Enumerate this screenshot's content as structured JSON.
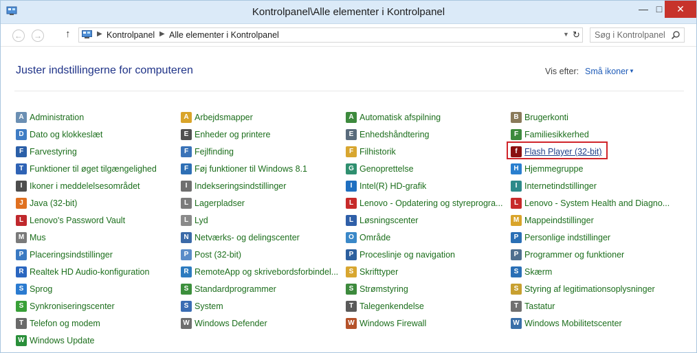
{
  "window": {
    "title": "Kontrolpanel\\Alle elementer i Kontrolpanel",
    "controls": {
      "minimize": "—",
      "maximize": "□",
      "close": "✕"
    }
  },
  "nav": {
    "back_icon": "←",
    "forward_icon": "→",
    "up_icon": "↑",
    "breadcrumb": [
      "Kontrolpanel",
      "Alle elementer i Kontrolpanel"
    ],
    "dropdown_icon": "▼",
    "refresh_icon": "↻",
    "search_placeholder": "Søg i Kontrolpanel"
  },
  "header": {
    "title": "Juster indstillingerne for computeren",
    "view_label": "Vis efter:",
    "view_value": "Små ikoner",
    "view_caret": "▼"
  },
  "columns": [
    [
      {
        "label": "Administration",
        "icon": "admin-tools-icon",
        "color": "#6b8fb3",
        "glyph": "A"
      },
      {
        "label": "Dato og klokkeslæt",
        "icon": "clock-icon",
        "color": "#3f7cc4",
        "glyph": "D"
      },
      {
        "label": "Farvestyring",
        "icon": "color-management-icon",
        "color": "#2b5fa8",
        "glyph": "F"
      },
      {
        "label": "Funktioner til øget tilgængelighed",
        "icon": "accessibility-icon",
        "color": "#2f63b5",
        "glyph": "T"
      },
      {
        "label": "Ikoner i meddelelsesområdet",
        "icon": "notification-icons-icon",
        "color": "#4d4d4d",
        "glyph": "I"
      },
      {
        "label": "Java (32-bit)",
        "icon": "java-icon",
        "color": "#e07020",
        "glyph": "J"
      },
      {
        "label": "Lenovo's Password Vault",
        "icon": "password-vault-icon",
        "color": "#c0282d",
        "glyph": "L"
      },
      {
        "label": "Mus",
        "icon": "mouse-icon",
        "color": "#7a7a7a",
        "glyph": "M"
      },
      {
        "label": "Placeringsindstillinger",
        "icon": "location-icon",
        "color": "#3a79c2",
        "glyph": "P"
      },
      {
        "label": "Realtek HD Audio-konfiguration",
        "icon": "realtek-audio-icon",
        "color": "#2a66c0",
        "glyph": "R"
      },
      {
        "label": "Sprog",
        "icon": "language-icon",
        "color": "#2b7bd0",
        "glyph": "S"
      },
      {
        "label": "Synkroniseringscenter",
        "icon": "sync-center-icon",
        "color": "#39a038",
        "glyph": "S"
      },
      {
        "label": "Telefon og modem",
        "icon": "phone-modem-icon",
        "color": "#6a6a6a",
        "glyph": "T"
      },
      {
        "label": "Windows Update",
        "icon": "windows-update-icon",
        "color": "#2a8f3a",
        "glyph": "W"
      }
    ],
    [
      {
        "label": "Arbejdsmapper",
        "icon": "work-folders-icon",
        "color": "#d9a42a",
        "glyph": "A"
      },
      {
        "label": "Enheder og printere",
        "icon": "devices-printers-icon",
        "color": "#505050",
        "glyph": "E"
      },
      {
        "label": "Fejlfinding",
        "icon": "troubleshooting-icon",
        "color": "#3a73b8",
        "glyph": "F"
      },
      {
        "label": "Føj funktioner til Windows 8.1",
        "icon": "add-features-icon",
        "color": "#2e6fb5",
        "glyph": "F"
      },
      {
        "label": "Indekseringsindstillinger",
        "icon": "indexing-icon",
        "color": "#6f6f6f",
        "glyph": "I"
      },
      {
        "label": "Lagerpladser",
        "icon": "storage-spaces-icon",
        "color": "#7b7b7b",
        "glyph": "L"
      },
      {
        "label": "Lyd",
        "icon": "sound-icon",
        "color": "#8a8a8a",
        "glyph": "L"
      },
      {
        "label": "Netværks- og delingscenter",
        "icon": "network-icon",
        "color": "#3b6aa8",
        "glyph": "N"
      },
      {
        "label": "Post (32-bit)",
        "icon": "mail-icon",
        "color": "#5a8cc8",
        "glyph": "P"
      },
      {
        "label": "RemoteApp og skrivebordsforbindel...",
        "icon": "remoteapp-icon",
        "color": "#2d7bbf",
        "glyph": "R"
      },
      {
        "label": "Standardprogrammer",
        "icon": "default-programs-icon",
        "color": "#3c8f3c",
        "glyph": "S"
      },
      {
        "label": "System",
        "icon": "system-icon",
        "color": "#3b6db3",
        "glyph": "S"
      },
      {
        "label": "Windows Defender",
        "icon": "windows-defender-icon",
        "color": "#6e6e6e",
        "glyph": "W"
      }
    ],
    [
      {
        "label": "Automatisk afspilning",
        "icon": "autoplay-icon",
        "color": "#3d8a3d",
        "glyph": "A"
      },
      {
        "label": "Enhedshåndtering",
        "icon": "device-manager-icon",
        "color": "#5a6b7c",
        "glyph": "E"
      },
      {
        "label": "Filhistorik",
        "icon": "file-history-icon",
        "color": "#d8a630",
        "glyph": "F"
      },
      {
        "label": "Genoprettelse",
        "icon": "recovery-icon",
        "color": "#2f8f6f",
        "glyph": "G"
      },
      {
        "label": "Intel(R) HD-grafik",
        "icon": "intel-graphics-icon",
        "color": "#1f6fc0",
        "glyph": "I"
      },
      {
        "label": "Lenovo - Opdatering og styreprogra...",
        "icon": "lenovo-update-icon",
        "color": "#c72a2a",
        "glyph": "L"
      },
      {
        "label": "Løsningscenter",
        "icon": "action-center-icon",
        "color": "#2f5fa8",
        "glyph": "L"
      },
      {
        "label": "Område",
        "icon": "region-icon",
        "color": "#3a88c8",
        "glyph": "O"
      },
      {
        "label": "Proceslinje og navigation",
        "icon": "taskbar-icon",
        "color": "#2c5f9e",
        "glyph": "P"
      },
      {
        "label": "Skrifttyper",
        "icon": "fonts-icon",
        "color": "#d8a630",
        "glyph": "S"
      },
      {
        "label": "Strømstyring",
        "icon": "power-options-icon",
        "color": "#3d8a3d",
        "glyph": "S"
      },
      {
        "label": "Talegenkendelse",
        "icon": "speech-recognition-icon",
        "color": "#5a5a5a",
        "glyph": "T"
      },
      {
        "label": "Windows Firewall",
        "icon": "firewall-icon",
        "color": "#b5522a",
        "glyph": "W"
      }
    ],
    [
      {
        "label": "Brugerkonti",
        "icon": "user-accounts-icon",
        "color": "#8a7a5a",
        "glyph": "B"
      },
      {
        "label": "Familiesikkerhed",
        "icon": "family-safety-icon",
        "color": "#3d8a3d",
        "glyph": "F"
      },
      {
        "label": "Flash Player (32-bit)",
        "icon": "flash-player-icon",
        "color": "#8a1010",
        "glyph": "f"
      },
      {
        "label": "Hjemmegruppe",
        "icon": "homegroup-icon",
        "color": "#2a7fcf",
        "glyph": "H"
      },
      {
        "label": "Internetindstillinger",
        "icon": "internet-options-icon",
        "color": "#2e8a8a",
        "glyph": "I"
      },
      {
        "label": "Lenovo - System Health and Diagno...",
        "icon": "lenovo-health-icon",
        "color": "#c72a2a",
        "glyph": "L"
      },
      {
        "label": "Mappeindstillinger",
        "icon": "folder-options-icon",
        "color": "#d9a42a",
        "glyph": "M"
      },
      {
        "label": "Personlige indstillinger",
        "icon": "personalization-icon",
        "color": "#2a6fb5",
        "glyph": "P"
      },
      {
        "label": "Programmer og funktioner",
        "icon": "programs-features-icon",
        "color": "#4f6f8f",
        "glyph": "P"
      },
      {
        "label": "Skærm",
        "icon": "display-icon",
        "color": "#2a6fb5",
        "glyph": "S"
      },
      {
        "label": "Styring af legitimationsoplysninger",
        "icon": "credential-manager-icon",
        "color": "#c8a030",
        "glyph": "S"
      },
      {
        "label": "Tastatur",
        "icon": "keyboard-icon",
        "color": "#707070",
        "glyph": "T"
      },
      {
        "label": "Windows Mobilitetscenter",
        "icon": "mobility-center-icon",
        "color": "#3a6fa8",
        "glyph": "W"
      }
    ]
  ],
  "highlighted_item": "Flash Player (32-bit)",
  "colors": {
    "link": "#1c6e1c",
    "heading": "#1e3287",
    "highlight": "#d0242a",
    "titlebar": "#dbeaf8",
    "close": "#c7332b"
  }
}
